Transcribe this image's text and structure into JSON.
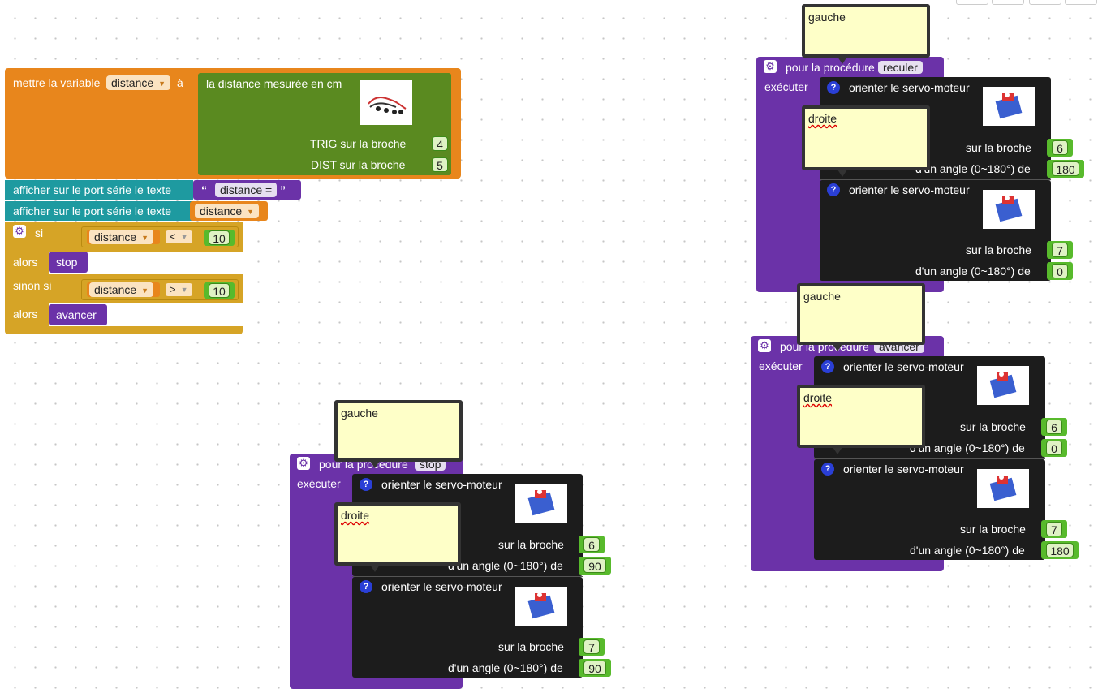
{
  "main": {
    "set_var_label": "mettre la variable",
    "var_name": "distance",
    "to_label": "à",
    "sensor_label": "la distance mesurée en cm",
    "trig_label": "TRIG sur la broche",
    "trig_pin": "4",
    "dist_label": "DIST sur la broche",
    "dist_pin": "5",
    "serial_label_1": "afficher sur le port série le texte",
    "serial_text_open": "“",
    "serial_text": "distance =",
    "serial_text_close": "”",
    "serial_label_2": "afficher sur le port série le texte",
    "serial_var": "distance",
    "if_label": "si",
    "cond1_var": "distance",
    "cond1_op": "<",
    "cond1_val": "10",
    "then_label_1": "alors",
    "call_1": "stop",
    "elseif_label": "sinon si",
    "cond2_var": "distance",
    "cond2_op": ">",
    "cond2_val": "10",
    "then_label_2": "alors",
    "call_2": "avancer"
  },
  "procedures": {
    "common": {
      "header_prefix": "pour la procédure",
      "execute_label": "exécuter",
      "servo_label": "orienter le servo-moteur",
      "pin_label": "sur la broche",
      "angle_label": "d'un angle (0~180°) de",
      "note_left": "gauche",
      "note_right": "droite",
      "help_glyph": "?"
    },
    "reculer": {
      "name": "reculer",
      "pin1": "6",
      "angle1": "180",
      "pin2": "7",
      "angle2": "0"
    },
    "avancer": {
      "name": "avancer",
      "pin1": "6",
      "angle1": "0",
      "pin2": "7",
      "angle2": "180"
    },
    "stop": {
      "name": "stop",
      "pin1": "6",
      "angle1": "90",
      "pin2": "7",
      "angle2": "90"
    }
  },
  "icons": {
    "gear": "⚙",
    "dropdown": "▼"
  },
  "colors": {
    "variable": "#e8861c",
    "sensor": "#5a8a20",
    "serial": "#1e9aa0",
    "logic": "#d6a426",
    "procedure": "#6b32a8",
    "servo": "#1c1c1c",
    "number": "#58ba2c"
  }
}
